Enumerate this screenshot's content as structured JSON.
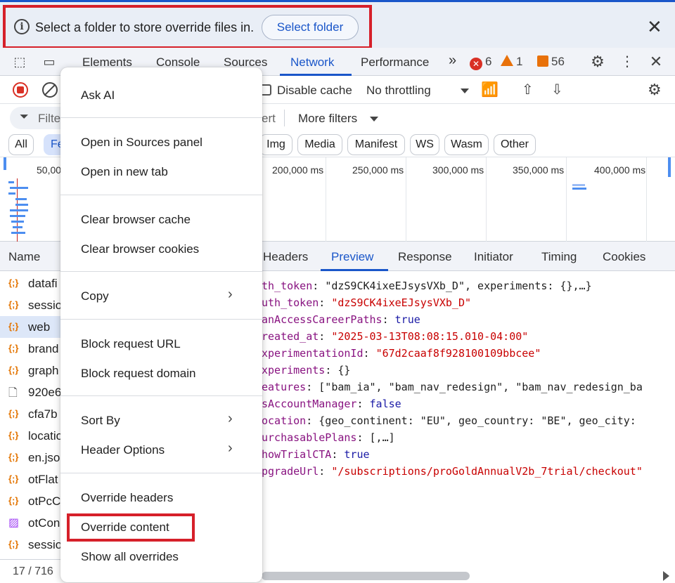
{
  "infobar": {
    "message": "Select a folder to store override files in.",
    "select_folder_label": "Select folder",
    "close_glyph": "✕",
    "info_glyph": "i"
  },
  "tabs": {
    "items": [
      "Elements",
      "Console",
      "Sources",
      "Network",
      "Performance"
    ],
    "active": "Network",
    "more_glyph": "»",
    "errors": "6",
    "warnings": "1",
    "issues": "56"
  },
  "toolbar": {
    "disable_cache_label": "Disable cache",
    "throttling_value": "No throttling"
  },
  "filter": {
    "placeholder_fragment": "Filte",
    "invert_fragment": "ert",
    "more_filters_label": "More filters"
  },
  "chips": {
    "all": "All",
    "fetch_fragment": "Fe",
    "img": "Img",
    "media": "Media",
    "manifest": "Manifest",
    "ws": "WS",
    "wasm": "Wasm",
    "other": "Other"
  },
  "overview": {
    "labels": [
      "50,00",
      "200,000 ms",
      "250,000 ms",
      "300,000 ms",
      "350,000 ms",
      "400,000 ms"
    ]
  },
  "requests": {
    "header": "Name",
    "rows": [
      {
        "name": "datafi",
        "type": "fetch",
        "icon": "{;}"
      },
      {
        "name": "sessio",
        "type": "fetch",
        "icon": "{;}"
      },
      {
        "name": "web",
        "type": "fetch",
        "icon": "{;}",
        "selected": true
      },
      {
        "name": "brand",
        "type": "fetch",
        "icon": "{;}"
      },
      {
        "name": "graph",
        "type": "fetch",
        "icon": "{;}"
      },
      {
        "name": "920e6",
        "type": "document",
        "icon": "🗋"
      },
      {
        "name": "cfa7b",
        "type": "fetch",
        "icon": "{;}"
      },
      {
        "name": "locatio",
        "type": "fetch",
        "icon": "{;}"
      },
      {
        "name": "en.jso",
        "type": "fetch",
        "icon": "{;}"
      },
      {
        "name": "otFlat",
        "type": "fetch",
        "icon": "{;}"
      },
      {
        "name": "otPcC",
        "type": "fetch",
        "icon": "{;}"
      },
      {
        "name": "otCon",
        "type": "image",
        "icon": "▨"
      },
      {
        "name": "sessio",
        "type": "fetch",
        "icon": "{;}"
      }
    ],
    "status": "17 / 716"
  },
  "detail_tabs": {
    "items": [
      "Headers",
      "Preview",
      "Response",
      "Initiator",
      "Timing",
      "Cookies"
    ],
    "active": "Preview"
  },
  "preview": {
    "lines": [
      {
        "key": "th_token",
        "sep": ": ",
        "value": "\"dzS9CK4ixeEJsysVXb_D\", experiments: {},…}",
        "kind": "plain"
      },
      {
        "key": "uth_token",
        "sep": ": ",
        "value": "\"dzS9CK4ixeEJsysVXb_D\"",
        "kind": "str"
      },
      {
        "key": "anAccessCareerPaths",
        "sep": ": ",
        "value": "true",
        "kind": "bool"
      },
      {
        "key": "reated_at",
        "sep": ": ",
        "value": "\"2025-03-13T08:08:15.010-04:00\"",
        "kind": "str"
      },
      {
        "key": "xperimentationId",
        "sep": ": ",
        "value": "\"67d2caaf8f928100109bbcee\"",
        "kind": "str"
      },
      {
        "key": "xperiments",
        "sep": ": ",
        "value": "{}",
        "kind": "plain"
      },
      {
        "key": "eatures",
        "sep": ": ",
        "value": "[\"bam_ia\", \"bam_nav_redesign\", \"bam_nav_redesign_ba",
        "kind": "plain"
      },
      {
        "key": "sAccountManager",
        "sep": ": ",
        "value": "false",
        "kind": "bool"
      },
      {
        "key": "ocation",
        "sep": ": ",
        "value": "{geo_continent: \"EU\", geo_country: \"BE\", geo_city:",
        "kind": "plain"
      },
      {
        "key": "urchasablePlans",
        "sep": ": ",
        "value": "[,…]",
        "kind": "plain"
      },
      {
        "key": "howTrialCTA",
        "sep": ": ",
        "value": "true",
        "kind": "bool"
      },
      {
        "key": "pgradeUrl",
        "sep": ": ",
        "value": "\"/subscriptions/proGoldAnnualV2b_7trial/checkout\"",
        "kind": "str"
      }
    ]
  },
  "context_menu": {
    "ask_ai": "Ask AI",
    "open_in_sources": "Open in Sources panel",
    "open_in_new_tab": "Open in new tab",
    "clear_cache": "Clear browser cache",
    "clear_cookies": "Clear browser cookies",
    "copy": "Copy",
    "block_url": "Block request URL",
    "block_domain": "Block request domain",
    "sort_by": "Sort By",
    "header_options": "Header Options",
    "override_headers": "Override headers",
    "override_content": "Override content",
    "show_all_overrides": "Show all overrides",
    "submenu_glyph": "›"
  },
  "colors": {
    "accent": "#1a56c9",
    "highlight_box": "#d6202a",
    "error": "#d93025",
    "warning": "#e8710a"
  }
}
